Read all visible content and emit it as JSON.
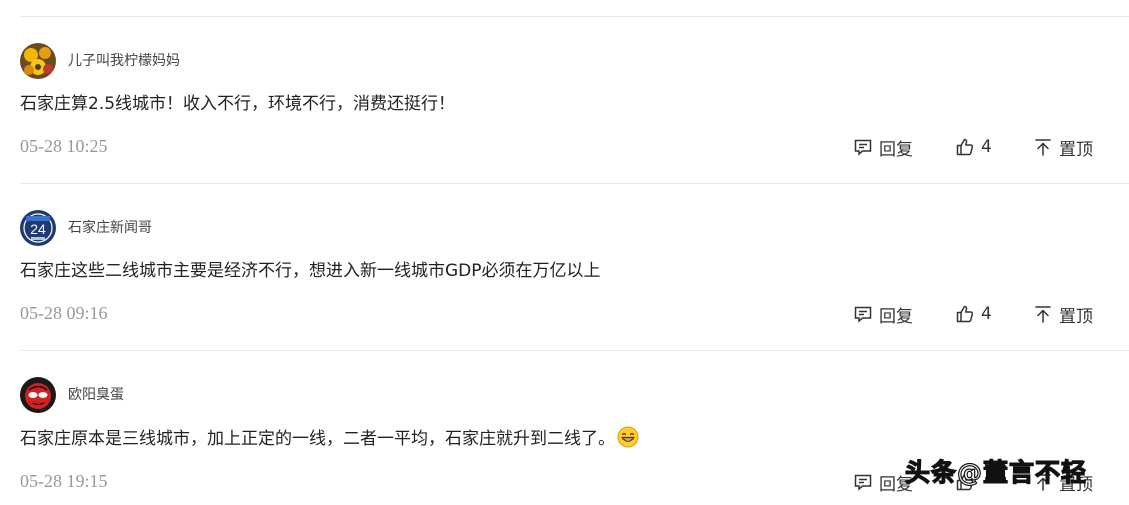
{
  "comments": [
    {
      "username": "儿子叫我柠檬妈妈",
      "text": "石家庄算2.5线城市！收入不行，环境不行，消费还挺行！",
      "time": "05-28 10:25",
      "reply_label": "回复",
      "like_count": "4",
      "pin_label": "置顶"
    },
    {
      "username": "石家庄新闻哥",
      "avatar_text": "24",
      "text": "石家庄这些二线城市主要是经济不行，想进入新一线城市GDP必须在万亿以上",
      "time": "05-28 09:16",
      "reply_label": "回复",
      "like_count": "4",
      "pin_label": "置顶"
    },
    {
      "username": "欧阳臭蛋",
      "text": "石家庄原本是三线城市，加上正定的一线，二者一平均，石家庄就升到二线了。",
      "time": "05-28 19:15",
      "reply_label": "回复",
      "pin_label": "置顶"
    }
  ],
  "watermark": "头条@董言不轻",
  "icons": {
    "reply": "comment-icon",
    "like": "thumbs-up-icon",
    "pin": "pin-to-top-icon",
    "emoji": "grinning-face-icon"
  }
}
